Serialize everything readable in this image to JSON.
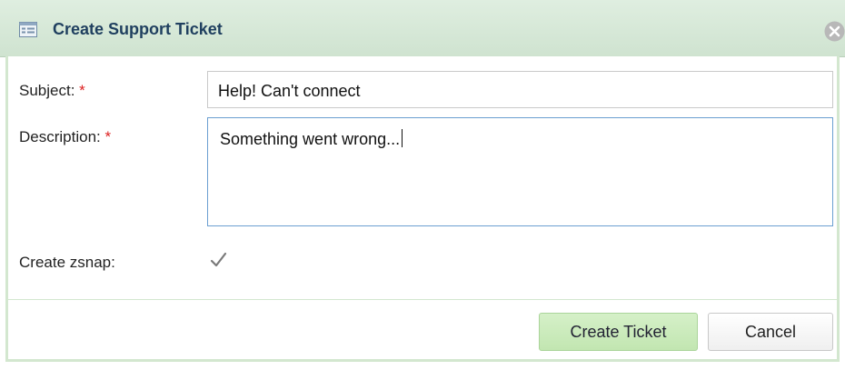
{
  "dialog": {
    "title": "Create Support Ticket",
    "title_icon": "form-icon",
    "close_icon": "close-icon"
  },
  "form": {
    "subject_label": "Subject:",
    "subject_required": "*",
    "subject_value": "Help! Can't connect",
    "description_label": "Description:",
    "description_required": "*",
    "description_value": "Something went wrong...",
    "zsnap_label": "Create zsnap:",
    "zsnap_checked": true
  },
  "buttons": {
    "create_label": "Create Ticket",
    "cancel_label": "Cancel"
  },
  "colors": {
    "titlebar": "#cfe3d0",
    "primary_button": "#c2e6b1",
    "required_star": "#dd2222",
    "focus_border": "#6b9fd1"
  }
}
